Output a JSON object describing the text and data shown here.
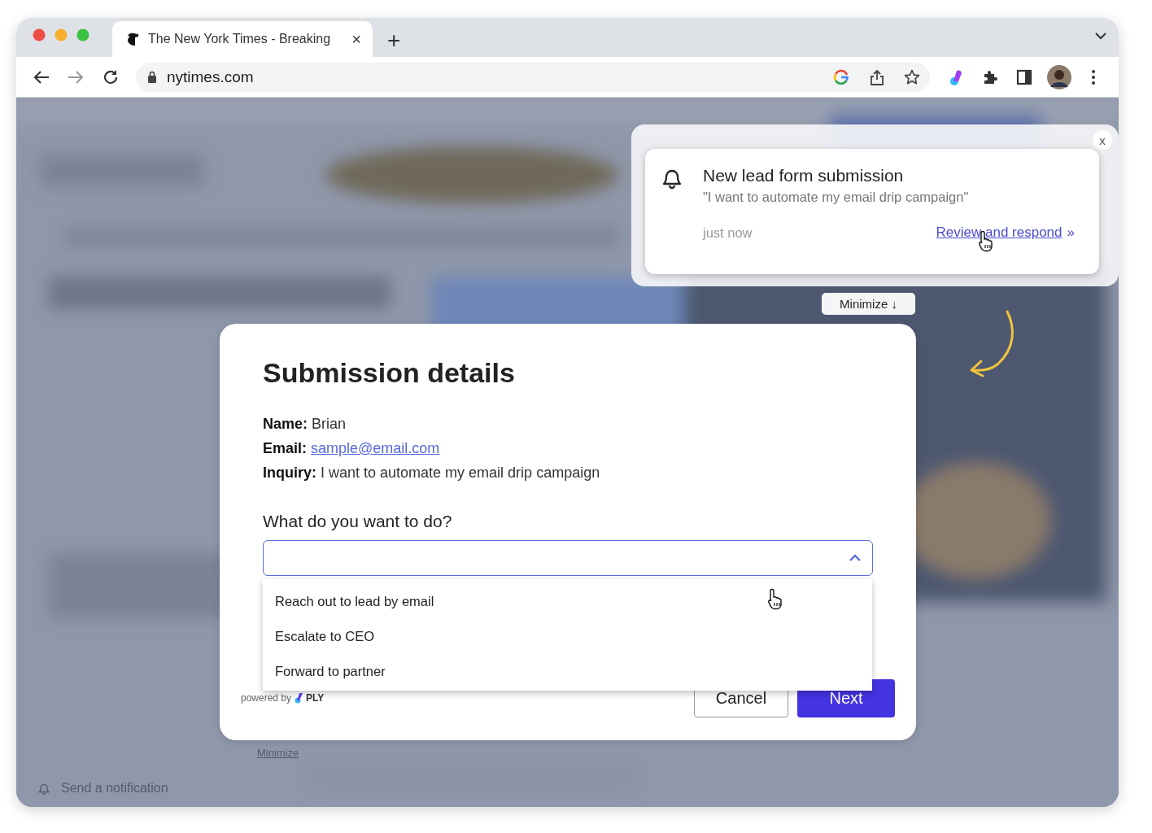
{
  "browser": {
    "tab": {
      "title": "The New York Times - Breaking",
      "close": "×"
    },
    "new_tab": "+",
    "url": "nytimes.com"
  },
  "page": {
    "minimize_link": "Minimize",
    "notification_button": "Send a notification"
  },
  "toast": {
    "close": "x",
    "title": "New lead form submission",
    "quote": "\"I want to automate my email drip campaign\"",
    "time": "just now",
    "link": "Review and respond",
    "link_suffix": "»",
    "minimize": "Minimize ↓"
  },
  "modal": {
    "title": "Submission details",
    "fields": [
      {
        "label": "Name:",
        "value": "Brian",
        "kind": "text"
      },
      {
        "label": "Email:",
        "value": "sample@email.com",
        "kind": "link"
      },
      {
        "label": "Inquiry:",
        "value": "I want to automate my email drip campaign",
        "kind": "text"
      }
    ],
    "question": "What do you want to do?",
    "select": {
      "expanded": true,
      "options": [
        "Reach out to lead by email",
        "Escalate to CEO",
        "Forward to partner"
      ]
    },
    "powered_by": "powered by",
    "brand": "PLY",
    "buttons": [
      {
        "label": "Cancel",
        "kind": "secondary"
      },
      {
        "label": "Next",
        "kind": "primary"
      }
    ]
  }
}
